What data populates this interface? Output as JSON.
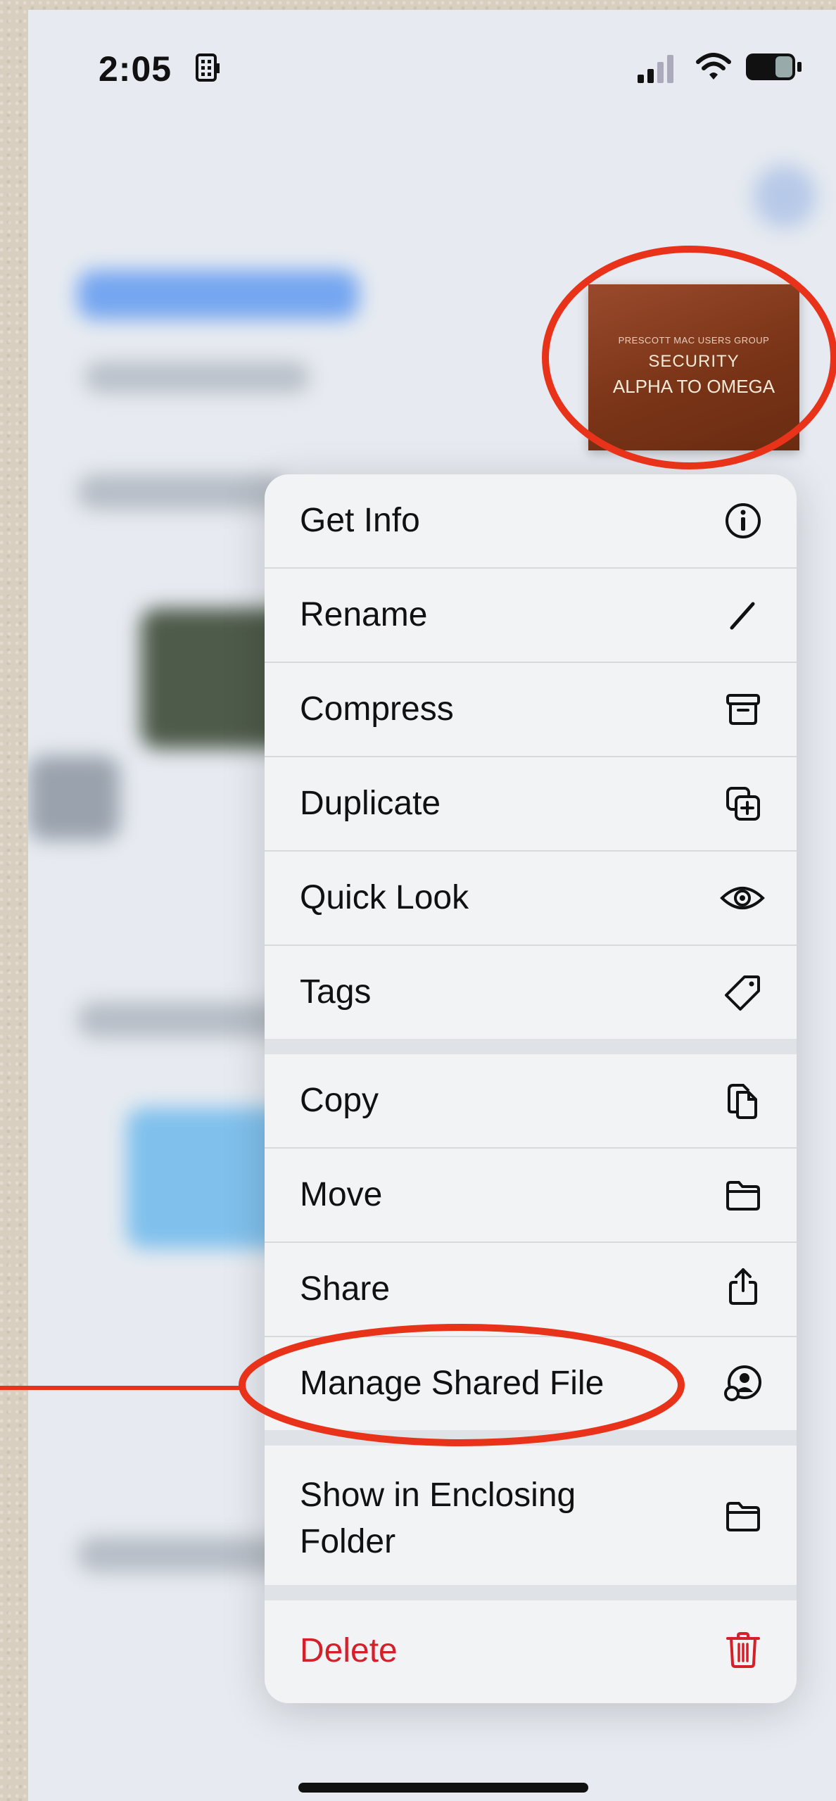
{
  "status_bar": {
    "time": "2:05"
  },
  "thumbnail": {
    "small_text": "PRESCOTT MAC USERS GROUP",
    "line1": "SECURITY",
    "line2": "ALPHA TO OMEGA"
  },
  "menu": {
    "items": [
      {
        "label": "Get Info",
        "icon": "info-icon"
      },
      {
        "label": "Rename",
        "icon": "pencil-icon"
      },
      {
        "label": "Compress",
        "icon": "archive-box-icon"
      },
      {
        "label": "Duplicate",
        "icon": "duplicate-icon"
      },
      {
        "label": "Quick Look",
        "icon": "eye-icon"
      },
      {
        "label": "Tags",
        "icon": "tag-icon"
      },
      {
        "label": "Copy",
        "icon": "copy-doc-icon"
      },
      {
        "label": "Move",
        "icon": "folder-icon"
      },
      {
        "label": "Share",
        "icon": "share-icon"
      },
      {
        "label": "Manage Shared File",
        "icon": "shared-person-icon"
      },
      {
        "label": "Show in Enclosing Folder",
        "icon": "folder-icon"
      },
      {
        "label": "Delete",
        "icon": "trash-icon"
      }
    ]
  },
  "colors": {
    "destructive": "#d4202a",
    "callout": "#e8321a",
    "thumbnail": "#7a3417"
  }
}
